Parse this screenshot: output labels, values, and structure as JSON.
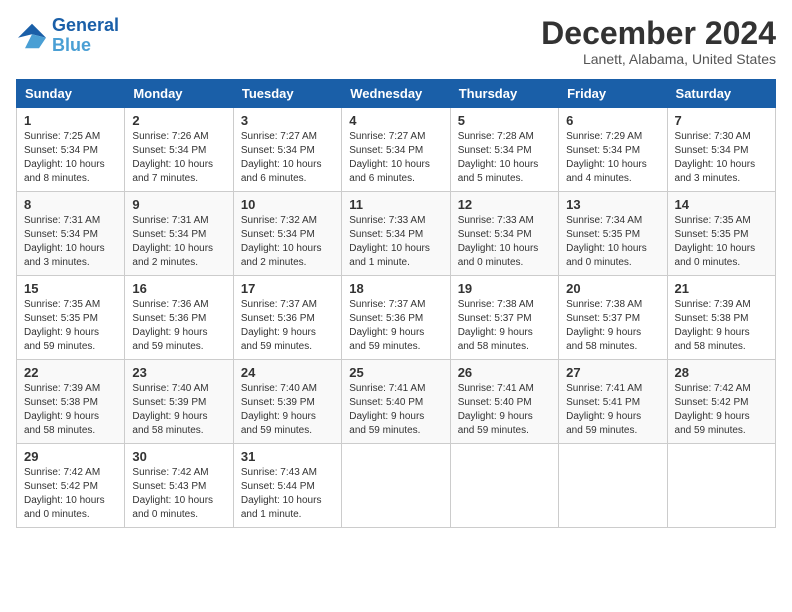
{
  "logo": {
    "line1": "General",
    "line2": "Blue"
  },
  "title": "December 2024",
  "subtitle": "Lanett, Alabama, United States",
  "weekdays": [
    "Sunday",
    "Monday",
    "Tuesday",
    "Wednesday",
    "Thursday",
    "Friday",
    "Saturday"
  ],
  "weeks": [
    [
      {
        "day": "1",
        "info": "Sunrise: 7:25 AM\nSunset: 5:34 PM\nDaylight: 10 hours\nand 8 minutes."
      },
      {
        "day": "2",
        "info": "Sunrise: 7:26 AM\nSunset: 5:34 PM\nDaylight: 10 hours\nand 7 minutes."
      },
      {
        "day": "3",
        "info": "Sunrise: 7:27 AM\nSunset: 5:34 PM\nDaylight: 10 hours\nand 6 minutes."
      },
      {
        "day": "4",
        "info": "Sunrise: 7:27 AM\nSunset: 5:34 PM\nDaylight: 10 hours\nand 6 minutes."
      },
      {
        "day": "5",
        "info": "Sunrise: 7:28 AM\nSunset: 5:34 PM\nDaylight: 10 hours\nand 5 minutes."
      },
      {
        "day": "6",
        "info": "Sunrise: 7:29 AM\nSunset: 5:34 PM\nDaylight: 10 hours\nand 4 minutes."
      },
      {
        "day": "7",
        "info": "Sunrise: 7:30 AM\nSunset: 5:34 PM\nDaylight: 10 hours\nand 3 minutes."
      }
    ],
    [
      {
        "day": "8",
        "info": "Sunrise: 7:31 AM\nSunset: 5:34 PM\nDaylight: 10 hours\nand 3 minutes."
      },
      {
        "day": "9",
        "info": "Sunrise: 7:31 AM\nSunset: 5:34 PM\nDaylight: 10 hours\nand 2 minutes."
      },
      {
        "day": "10",
        "info": "Sunrise: 7:32 AM\nSunset: 5:34 PM\nDaylight: 10 hours\nand 2 minutes."
      },
      {
        "day": "11",
        "info": "Sunrise: 7:33 AM\nSunset: 5:34 PM\nDaylight: 10 hours\nand 1 minute."
      },
      {
        "day": "12",
        "info": "Sunrise: 7:33 AM\nSunset: 5:34 PM\nDaylight: 10 hours\nand 0 minutes."
      },
      {
        "day": "13",
        "info": "Sunrise: 7:34 AM\nSunset: 5:35 PM\nDaylight: 10 hours\nand 0 minutes."
      },
      {
        "day": "14",
        "info": "Sunrise: 7:35 AM\nSunset: 5:35 PM\nDaylight: 10 hours\nand 0 minutes."
      }
    ],
    [
      {
        "day": "15",
        "info": "Sunrise: 7:35 AM\nSunset: 5:35 PM\nDaylight: 9 hours\nand 59 minutes."
      },
      {
        "day": "16",
        "info": "Sunrise: 7:36 AM\nSunset: 5:36 PM\nDaylight: 9 hours\nand 59 minutes."
      },
      {
        "day": "17",
        "info": "Sunrise: 7:37 AM\nSunset: 5:36 PM\nDaylight: 9 hours\nand 59 minutes."
      },
      {
        "day": "18",
        "info": "Sunrise: 7:37 AM\nSunset: 5:36 PM\nDaylight: 9 hours\nand 59 minutes."
      },
      {
        "day": "19",
        "info": "Sunrise: 7:38 AM\nSunset: 5:37 PM\nDaylight: 9 hours\nand 58 minutes."
      },
      {
        "day": "20",
        "info": "Sunrise: 7:38 AM\nSunset: 5:37 PM\nDaylight: 9 hours\nand 58 minutes."
      },
      {
        "day": "21",
        "info": "Sunrise: 7:39 AM\nSunset: 5:38 PM\nDaylight: 9 hours\nand 58 minutes."
      }
    ],
    [
      {
        "day": "22",
        "info": "Sunrise: 7:39 AM\nSunset: 5:38 PM\nDaylight: 9 hours\nand 58 minutes."
      },
      {
        "day": "23",
        "info": "Sunrise: 7:40 AM\nSunset: 5:39 PM\nDaylight: 9 hours\nand 58 minutes."
      },
      {
        "day": "24",
        "info": "Sunrise: 7:40 AM\nSunset: 5:39 PM\nDaylight: 9 hours\nand 59 minutes."
      },
      {
        "day": "25",
        "info": "Sunrise: 7:41 AM\nSunset: 5:40 PM\nDaylight: 9 hours\nand 59 minutes."
      },
      {
        "day": "26",
        "info": "Sunrise: 7:41 AM\nSunset: 5:40 PM\nDaylight: 9 hours\nand 59 minutes."
      },
      {
        "day": "27",
        "info": "Sunrise: 7:41 AM\nSunset: 5:41 PM\nDaylight: 9 hours\nand 59 minutes."
      },
      {
        "day": "28",
        "info": "Sunrise: 7:42 AM\nSunset: 5:42 PM\nDaylight: 9 hours\nand 59 minutes."
      }
    ],
    [
      {
        "day": "29",
        "info": "Sunrise: 7:42 AM\nSunset: 5:42 PM\nDaylight: 10 hours\nand 0 minutes."
      },
      {
        "day": "30",
        "info": "Sunrise: 7:42 AM\nSunset: 5:43 PM\nDaylight: 10 hours\nand 0 minutes."
      },
      {
        "day": "31",
        "info": "Sunrise: 7:43 AM\nSunset: 5:44 PM\nDaylight: 10 hours\nand 1 minute."
      },
      null,
      null,
      null,
      null
    ]
  ]
}
